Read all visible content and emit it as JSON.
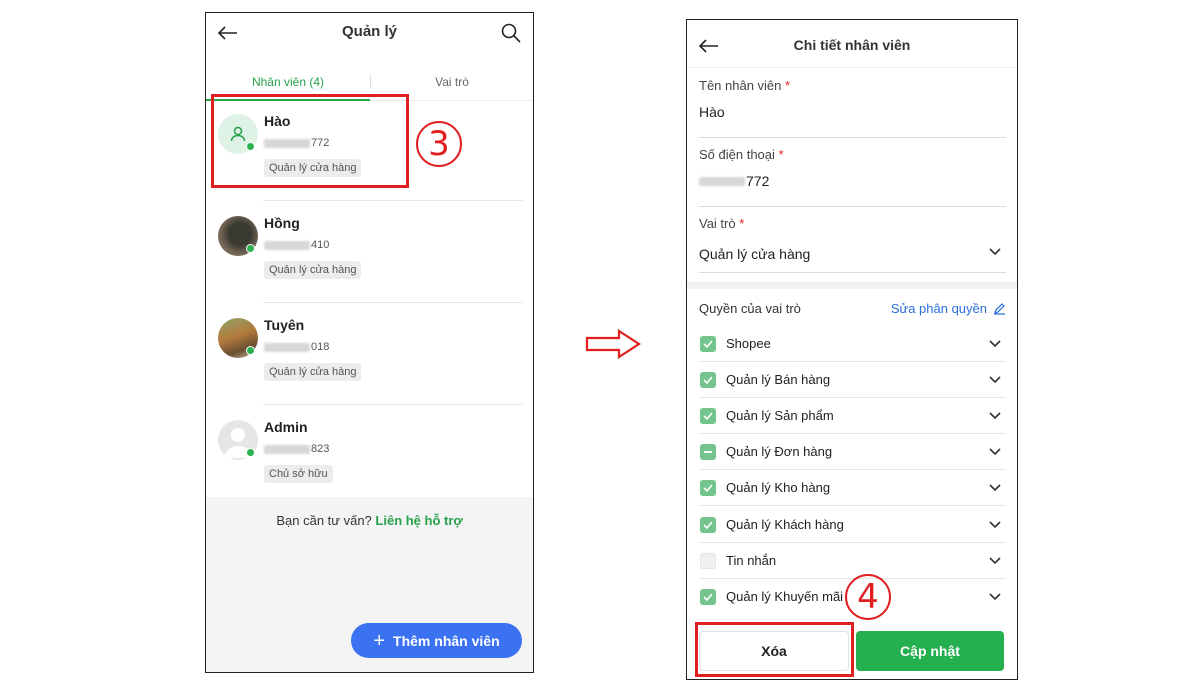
{
  "left_screen": {
    "title": "Quản lý",
    "tabs": [
      {
        "label": "Nhân viên (4)"
      },
      {
        "label": "Vai trò"
      }
    ],
    "employees": [
      {
        "name": "Hào",
        "phone_suffix": "772",
        "role": "Quản lý cửa hàng"
      },
      {
        "name": "Hồng",
        "phone_suffix": "410",
        "role": "Quản lý cửa hàng"
      },
      {
        "name": "Tuyên",
        "phone_suffix": "018",
        "role": "Quản lý cửa hàng"
      },
      {
        "name": "Admin",
        "phone_suffix": "823",
        "role": "Chủ sở hữu"
      }
    ],
    "support_prompt": "Bạn cần tư vấn?",
    "support_link": "Liên hệ hỗ trợ",
    "add_button": "Thêm nhân viên"
  },
  "right_screen": {
    "title": "Chi tiết nhân viên",
    "name_field": {
      "label": "Tên nhân viên",
      "required_mark": "*",
      "value": "Hào"
    },
    "phone_field": {
      "label": "Số điện thoại",
      "required_mark": "*",
      "value_suffix": "772"
    },
    "role_field": {
      "label": "Vai trò",
      "required_mark": "*",
      "value": "Quản lý cửa hàng"
    },
    "permissions_title": "Quyền của vai trò",
    "edit_permissions": "Sửa phân quyền",
    "permissions": [
      {
        "label": "Shopee",
        "state": "checked"
      },
      {
        "label": "Quản lý Bán hàng",
        "state": "checked"
      },
      {
        "label": "Quản lý Sản phẩm",
        "state": "checked"
      },
      {
        "label": "Quản lý Đơn hàng",
        "state": "partial"
      },
      {
        "label": "Quản lý Kho hàng",
        "state": "checked"
      },
      {
        "label": "Quản lý Khách hàng",
        "state": "checked"
      },
      {
        "label": "Tin nhắn",
        "state": "empty"
      },
      {
        "label": "Quản lý Khuyến mãi",
        "state": "checked"
      }
    ],
    "delete_button": "Xóa",
    "update_button": "Cập nhật"
  },
  "annotations": {
    "step_3": "3",
    "step_4": "4"
  },
  "colors": {
    "brand_green": "#27a04b",
    "primary_blue": "#3b72f2",
    "highlight_red": "#e02020",
    "update_green": "#24b04f",
    "checkbox_green": "#74c58d"
  }
}
